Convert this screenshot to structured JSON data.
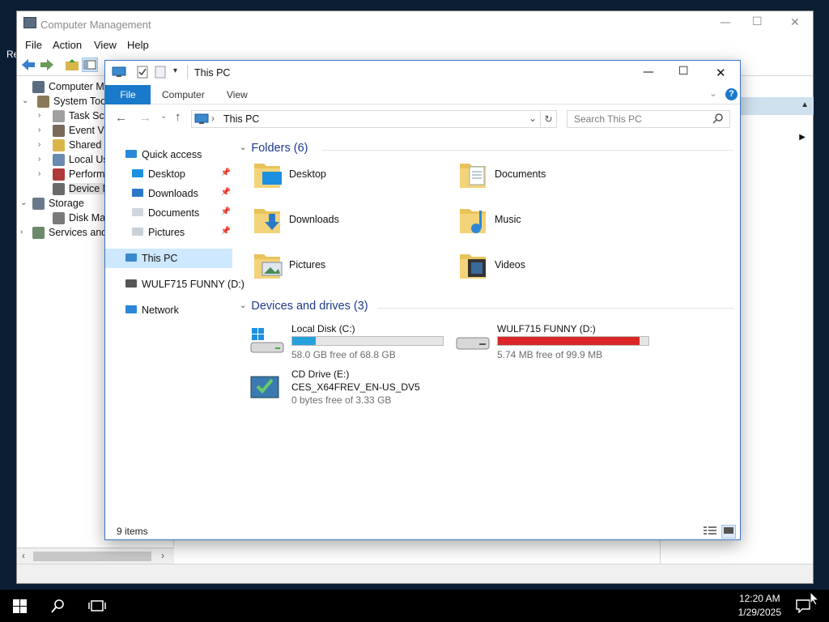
{
  "desktop": {
    "edge_text": "Re"
  },
  "computer_management": {
    "title": "Computer Management",
    "caption": {
      "minimize": "—",
      "maximize": "☐",
      "close": "✕"
    },
    "menu": [
      "File",
      "Action",
      "View",
      "Help"
    ],
    "tree": [
      {
        "label": "Computer Manag",
        "indent": 0,
        "chev": "",
        "icon": "computer-management-icon",
        "color": "#5a6c80"
      },
      {
        "label": "System Tools",
        "indent": 1,
        "chev": "⌄",
        "icon": "tools-icon",
        "color": "#8a7a58"
      },
      {
        "label": "Task Sch",
        "indent": 2,
        "chev": "›",
        "icon": "clock-icon",
        "color": "#a0a0a0"
      },
      {
        "label": "Event Vi",
        "indent": 2,
        "chev": "›",
        "icon": "event-viewer-icon",
        "color": "#7a6a5a"
      },
      {
        "label": "Shared F",
        "indent": 2,
        "chev": "›",
        "icon": "shared-folder-icon",
        "color": "#d9b54a"
      },
      {
        "label": "Local Us",
        "indent": 2,
        "chev": "›",
        "icon": "users-icon",
        "color": "#6a8ab0"
      },
      {
        "label": "Perform",
        "indent": 2,
        "chev": "›",
        "icon": "performance-icon",
        "color": "#b03a3a"
      },
      {
        "label": "Device M",
        "indent": 2,
        "chev": "",
        "icon": "device-manager-icon",
        "color": "#6a6a6a",
        "selected": true
      },
      {
        "label": "Storage",
        "indent": 0,
        "chev": "⌄",
        "icon": "storage-icon",
        "color": "#6a7a8a"
      },
      {
        "label": "Disk Mar",
        "indent": 2,
        "chev": "",
        "icon": "disk-icon",
        "color": "#7a7a7a"
      },
      {
        "label": "Services and",
        "indent": 0,
        "chev": "›",
        "icon": "services-icon",
        "color": "#6a8a6a"
      }
    ],
    "scroll": {
      "left": "‹",
      "right": "›"
    }
  },
  "explorer": {
    "title": "This PC",
    "caption": {
      "minimize": "—",
      "maximize": "☐",
      "close": "✕"
    },
    "ribbon": {
      "file": "File",
      "tabs": [
        "Computer",
        "View"
      ],
      "expand": "⌄",
      "help": "?"
    },
    "nav_buttons": {
      "back": "←",
      "forward": "→",
      "recent": "⌄",
      "up": "↑"
    },
    "address": {
      "chevron": "›",
      "path": "This PC",
      "dropdown": "⌄",
      "refresh": "↻"
    },
    "search": {
      "placeholder": "Search This PC"
    },
    "nav": [
      {
        "label": "Quick access",
        "icon": "star-icon",
        "color": "#2b88d8",
        "pin": false,
        "indent": 0
      },
      {
        "label": "Desktop",
        "icon": "desktop-icon",
        "color": "#1e90e0",
        "pin": true,
        "indent": 1
      },
      {
        "label": "Downloads",
        "icon": "download-arrow-icon",
        "color": "#2b78c8",
        "pin": true,
        "indent": 1
      },
      {
        "label": "Documents",
        "icon": "documents-icon",
        "color": "#cfd6de",
        "pin": true,
        "indent": 1
      },
      {
        "label": "Pictures",
        "icon": "pictures-icon",
        "color": "#c8d0d8",
        "pin": true,
        "indent": 1
      },
      {
        "label": "This PC",
        "icon": "this-pc-icon",
        "color": "#3a8ad0",
        "pin": false,
        "indent": 0,
        "selected": true
      },
      {
        "label": "WULF715 FUNNY (D:)",
        "icon": "usb-drive-icon",
        "color": "#555555",
        "pin": false,
        "indent": 0
      },
      {
        "label": "Network",
        "icon": "network-icon",
        "color": "#2b88d8",
        "pin": false,
        "indent": 0
      }
    ],
    "pin_glyph": "📌",
    "groups": {
      "folders": "Folders (6)",
      "devices": "Devices and drives (3)"
    },
    "folders": [
      {
        "label": "Desktop",
        "icon": "desktop-folder-icon"
      },
      {
        "label": "Documents",
        "icon": "documents-folder-icon"
      },
      {
        "label": "Downloads",
        "icon": "downloads-folder-icon"
      },
      {
        "label": "Music",
        "icon": "music-folder-icon"
      },
      {
        "label": "Pictures",
        "icon": "pictures-folder-icon"
      },
      {
        "label": "Videos",
        "icon": "videos-folder-icon"
      }
    ],
    "drives": [
      {
        "name": "Local Disk (C:)",
        "free": "58.0 GB free of 68.8 GB",
        "used_fraction": 0.157,
        "bar_color": "#26a0da",
        "icon": "windows-drive-icon",
        "has_bar": true
      },
      {
        "name": "WULF715 FUNNY (D:)",
        "free": "5.74 MB free of 99.9 MB",
        "used_fraction": 0.943,
        "bar_color": "#da2626",
        "icon": "removable-drive-icon",
        "has_bar": true
      },
      {
        "name": "CD Drive (E:)",
        "label2": "CES_X64FREV_EN-US_DV5",
        "free": "0 bytes free of 3.33 GB",
        "icon": "cd-drive-icon",
        "has_bar": false
      }
    ],
    "status": "9 items"
  },
  "taskbar": {
    "time": "12:20 AM",
    "date": "1/29/2025"
  }
}
